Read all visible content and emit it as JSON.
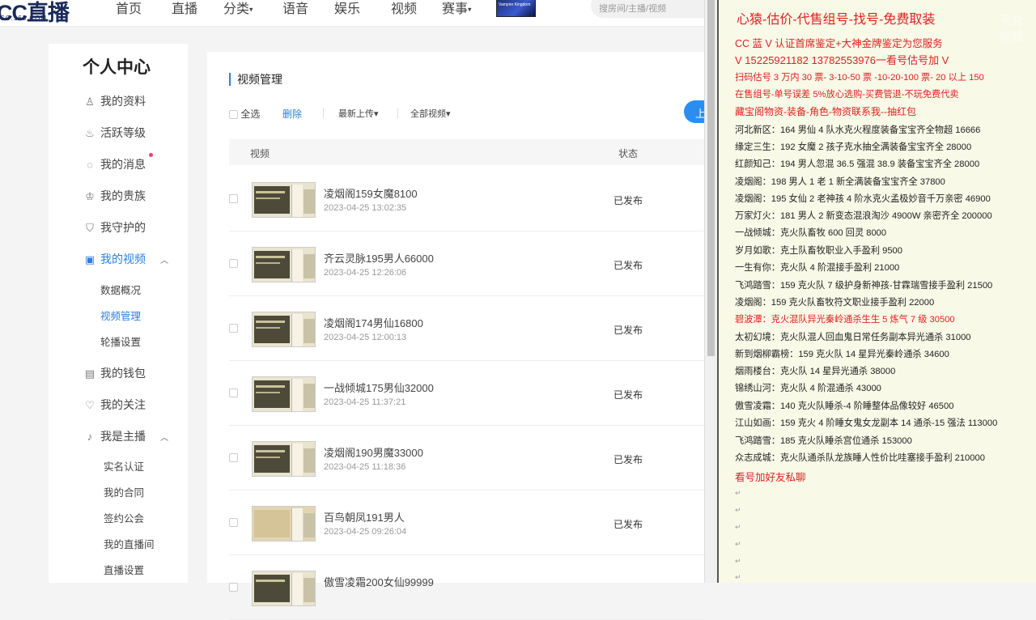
{
  "nav": {
    "logo": "CC直播",
    "logo_sub": "CC.163.COM",
    "items": [
      "首页",
      "直播",
      "分类",
      "语音",
      "娱乐",
      "视频",
      "赛事"
    ],
    "banner_text": "Vampire Kingdom",
    "search_placeholder": "搜房间/主播/视频"
  },
  "sidebar": {
    "title": "个人中心",
    "items": [
      {
        "label": "我的资料",
        "icon": "user-icon"
      },
      {
        "label": "活跃等级",
        "icon": "flame-icon"
      },
      {
        "label": "我的消息",
        "icon": "chat-icon"
      },
      {
        "label": "我的贵族",
        "icon": "crown-icon"
      },
      {
        "label": "我守护的",
        "icon": "shield-icon"
      },
      {
        "label": "我的视频",
        "icon": "video-icon"
      },
      {
        "label": "我的钱包",
        "icon": "wallet-icon"
      },
      {
        "label": "我的关注",
        "icon": "heart-icon"
      },
      {
        "label": "我是主播",
        "icon": "mic-icon"
      }
    ],
    "video_sub": [
      "数据概况",
      "视频管理",
      "轮播设置"
    ],
    "anchor_sub": [
      "实名认证",
      "我的合同",
      "签约公会",
      "我的直播间",
      "直播设置"
    ]
  },
  "content": {
    "title": "视频管理",
    "select_all": "全选",
    "delete": "删除",
    "sort": "最新上传",
    "filter": "全部视频",
    "upload": "上",
    "col_video": "视频",
    "col_status": "状态",
    "rows": [
      {
        "name": "凌烟阁159女魔8100",
        "time": "2023-04-25 13:02:35",
        "status": "已发布"
      },
      {
        "name": "齐云灵脉195男人66000",
        "time": "2023-04-25 12:26:06",
        "status": "已发布"
      },
      {
        "name": "凌烟阁174男仙16800",
        "time": "2023-04-25 12:00:13",
        "status": "已发布"
      },
      {
        "name": "一战倾城175男仙32000",
        "time": "2023-04-25 11:37:21",
        "status": "已发布"
      },
      {
        "name": "凌烟阁190男魔33000",
        "time": "2023-04-25 11:18:36",
        "status": "已发布"
      },
      {
        "name": "百鸟朝凤191男人",
        "time": "2023-04-25 09:26:04",
        "status": "已发布"
      },
      {
        "name": "傲雪凌霜200女仙99999",
        "time": "",
        "status": ""
      }
    ]
  },
  "ad": {
    "headline": "心猿-估价-代售组号-找号-免费取装",
    "lines_red": [
      "CC 蓝 V 认证首席鉴定+大神金牌鉴定为您服务",
      "V 15225921182      13782553976一看号估号加 V",
      "扫码估号 3 万内 30 票- 3-10-50 票  -10-20-100 票- 20 以上 150",
      "在售组号-单号误差 5%放心选购-买费管退-不玩免费代卖",
      "藏宝阁物资-装备-角色-物资联系我--抽红包"
    ],
    "lines": [
      "河北新区：164 男仙 4 队水克火程度装备宝宝齐全物超 16666",
      "缘定三生：192 女魔 2 孩子克水抽全满装备宝宝齐全 28000",
      "红颜知己：194 男人忽混 36.5 强混 38.9 装备宝宝齐全 28000",
      "凌烟阁：198 男人 1 老 1 新全满装备宝宝齐全 37800",
      "凌烟阁：195 女仙 2 老神孩 4 阶水克火孟极妙音千万亲密 46900",
      "万家灯火：181 男人 2 新变态混浪淘沙 4900W 亲密齐全 200000",
      "一战倾城：克火队畜牧 600 回灵 8000",
      "岁月如歌：克土队畜牧职业入手盈利 9500",
      "一生有你：克火队 4 阶混接手盈利 21000",
      "飞鸿踏雪：159 克火队 7 级护身新神孩-甘霖瑞雪接手盈利 21500",
      "凌烟阁：159 克火队畜牧符文职业接手盈利 22000",
      "碧波潭：克火混队异光秦岭通杀生生 5 炼气 7 级 30500",
      "太初幻境：克火队混人回血鬼日常任务副本异光通杀 31000",
      "新到烟柳霸榜：159 克火队 14 星异光秦岭通杀 34600",
      "烟雨楼台：克火队 14 星异光通杀 38000",
      "锦绣山河：克火队 4 阶混通杀 43000",
      "傲雪凌霜：140 克火队睡杀-4 阶睡整体品像较好 46500",
      "江山如画：159 克火 4 阶睡女鬼女龙副本 14 通杀-15 强法 113000",
      "飞鸿踏雪：185 克火队睡杀宫位通杀 153000",
      "众志成城：克火队通杀队龙族睡人性价比哇塞接手盈利 210000"
    ],
    "footer": "看号加好友私聊",
    "return_mark": "↵",
    "watermark": "天兑·巡视"
  },
  "colors": {
    "accent": "#2a80e0",
    "ad_red": "#e02020",
    "ad_bg": "#f9f9e8"
  }
}
